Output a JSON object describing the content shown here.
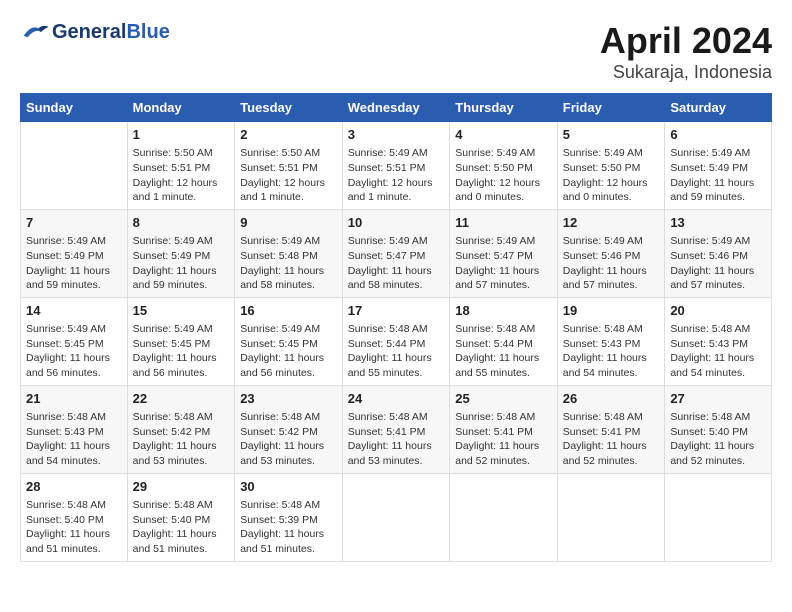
{
  "logo": {
    "general": "General",
    "blue": "Blue"
  },
  "title": "April 2024",
  "subtitle": "Sukaraja, Indonesia",
  "days_of_week": [
    "Sunday",
    "Monday",
    "Tuesday",
    "Wednesday",
    "Thursday",
    "Friday",
    "Saturday"
  ],
  "weeks": [
    [
      {
        "num": "",
        "info": ""
      },
      {
        "num": "1",
        "info": "Sunrise: 5:50 AM\nSunset: 5:51 PM\nDaylight: 12 hours\nand 1 minute."
      },
      {
        "num": "2",
        "info": "Sunrise: 5:50 AM\nSunset: 5:51 PM\nDaylight: 12 hours\nand 1 minute."
      },
      {
        "num": "3",
        "info": "Sunrise: 5:49 AM\nSunset: 5:51 PM\nDaylight: 12 hours\nand 1 minute."
      },
      {
        "num": "4",
        "info": "Sunrise: 5:49 AM\nSunset: 5:50 PM\nDaylight: 12 hours\nand 0 minutes."
      },
      {
        "num": "5",
        "info": "Sunrise: 5:49 AM\nSunset: 5:50 PM\nDaylight: 12 hours\nand 0 minutes."
      },
      {
        "num": "6",
        "info": "Sunrise: 5:49 AM\nSunset: 5:49 PM\nDaylight: 11 hours\nand 59 minutes."
      }
    ],
    [
      {
        "num": "7",
        "info": "Sunrise: 5:49 AM\nSunset: 5:49 PM\nDaylight: 11 hours\nand 59 minutes."
      },
      {
        "num": "8",
        "info": "Sunrise: 5:49 AM\nSunset: 5:49 PM\nDaylight: 11 hours\nand 59 minutes."
      },
      {
        "num": "9",
        "info": "Sunrise: 5:49 AM\nSunset: 5:48 PM\nDaylight: 11 hours\nand 58 minutes."
      },
      {
        "num": "10",
        "info": "Sunrise: 5:49 AM\nSunset: 5:47 PM\nDaylight: 11 hours\nand 58 minutes."
      },
      {
        "num": "11",
        "info": "Sunrise: 5:49 AM\nSunset: 5:47 PM\nDaylight: 11 hours\nand 57 minutes."
      },
      {
        "num": "12",
        "info": "Sunrise: 5:49 AM\nSunset: 5:46 PM\nDaylight: 11 hours\nand 57 minutes."
      },
      {
        "num": "13",
        "info": "Sunrise: 5:49 AM\nSunset: 5:46 PM\nDaylight: 11 hours\nand 57 minutes."
      }
    ],
    [
      {
        "num": "14",
        "info": "Sunrise: 5:49 AM\nSunset: 5:45 PM\nDaylight: 11 hours\nand 56 minutes."
      },
      {
        "num": "15",
        "info": "Sunrise: 5:49 AM\nSunset: 5:45 PM\nDaylight: 11 hours\nand 56 minutes."
      },
      {
        "num": "16",
        "info": "Sunrise: 5:49 AM\nSunset: 5:45 PM\nDaylight: 11 hours\nand 56 minutes."
      },
      {
        "num": "17",
        "info": "Sunrise: 5:48 AM\nSunset: 5:44 PM\nDaylight: 11 hours\nand 55 minutes."
      },
      {
        "num": "18",
        "info": "Sunrise: 5:48 AM\nSunset: 5:44 PM\nDaylight: 11 hours\nand 55 minutes."
      },
      {
        "num": "19",
        "info": "Sunrise: 5:48 AM\nSunset: 5:43 PM\nDaylight: 11 hours\nand 54 minutes."
      },
      {
        "num": "20",
        "info": "Sunrise: 5:48 AM\nSunset: 5:43 PM\nDaylight: 11 hours\nand 54 minutes."
      }
    ],
    [
      {
        "num": "21",
        "info": "Sunrise: 5:48 AM\nSunset: 5:43 PM\nDaylight: 11 hours\nand 54 minutes."
      },
      {
        "num": "22",
        "info": "Sunrise: 5:48 AM\nSunset: 5:42 PM\nDaylight: 11 hours\nand 53 minutes."
      },
      {
        "num": "23",
        "info": "Sunrise: 5:48 AM\nSunset: 5:42 PM\nDaylight: 11 hours\nand 53 minutes."
      },
      {
        "num": "24",
        "info": "Sunrise: 5:48 AM\nSunset: 5:41 PM\nDaylight: 11 hours\nand 53 minutes."
      },
      {
        "num": "25",
        "info": "Sunrise: 5:48 AM\nSunset: 5:41 PM\nDaylight: 11 hours\nand 52 minutes."
      },
      {
        "num": "26",
        "info": "Sunrise: 5:48 AM\nSunset: 5:41 PM\nDaylight: 11 hours\nand 52 minutes."
      },
      {
        "num": "27",
        "info": "Sunrise: 5:48 AM\nSunset: 5:40 PM\nDaylight: 11 hours\nand 52 minutes."
      }
    ],
    [
      {
        "num": "28",
        "info": "Sunrise: 5:48 AM\nSunset: 5:40 PM\nDaylight: 11 hours\nand 51 minutes."
      },
      {
        "num": "29",
        "info": "Sunrise: 5:48 AM\nSunset: 5:40 PM\nDaylight: 11 hours\nand 51 minutes."
      },
      {
        "num": "30",
        "info": "Sunrise: 5:48 AM\nSunset: 5:39 PM\nDaylight: 11 hours\nand 51 minutes."
      },
      {
        "num": "",
        "info": ""
      },
      {
        "num": "",
        "info": ""
      },
      {
        "num": "",
        "info": ""
      },
      {
        "num": "",
        "info": ""
      }
    ]
  ]
}
